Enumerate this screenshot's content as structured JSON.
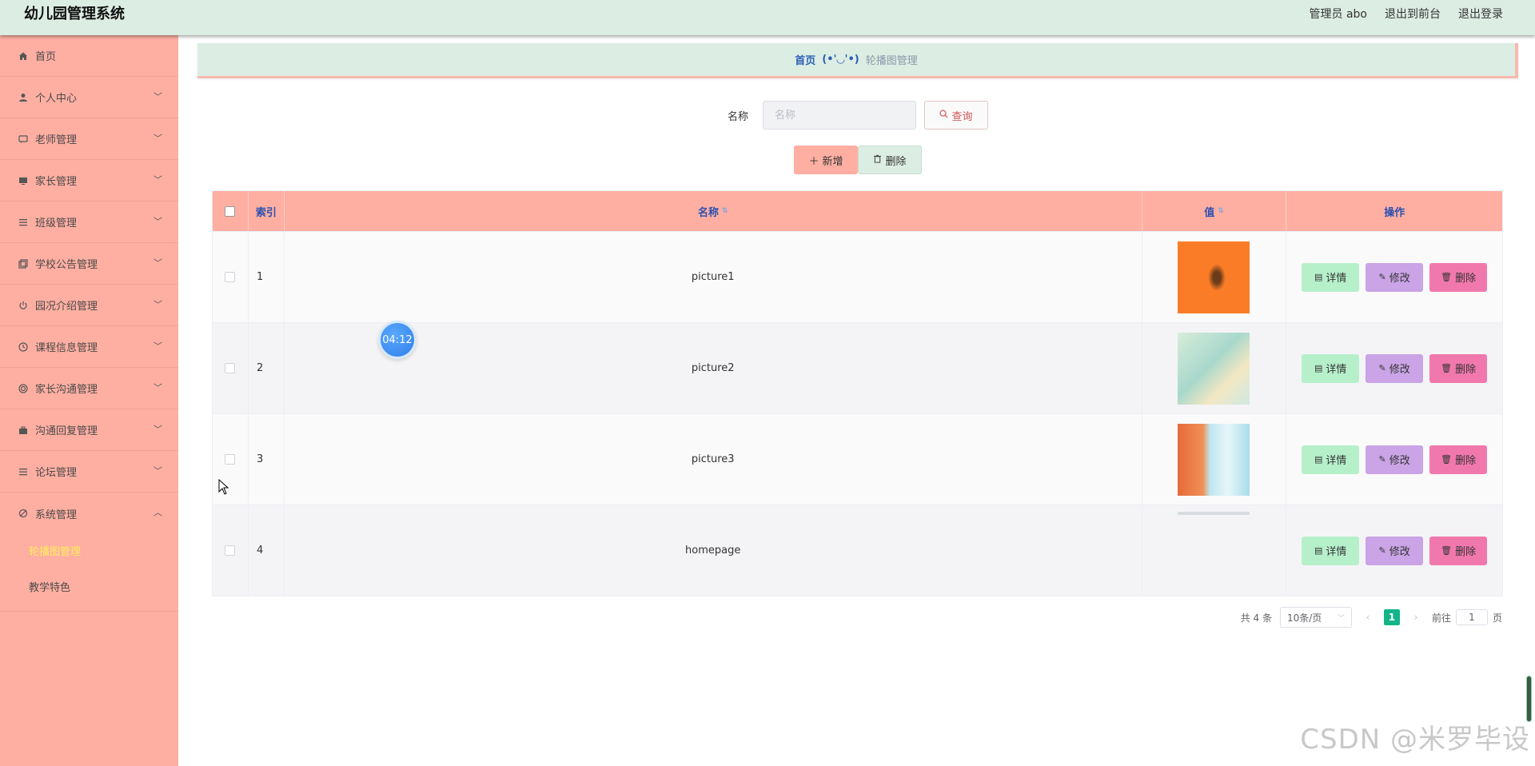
{
  "header": {
    "title": "幼儿园管理系统",
    "links": [
      "管理员 abo",
      "退出到前台",
      "退出登录"
    ]
  },
  "sidebar": {
    "items": [
      {
        "label": "首页",
        "icon": "home-icon"
      },
      {
        "label": "个人中心",
        "icon": "user-icon"
      },
      {
        "label": "老师管理",
        "icon": "chat-icon"
      },
      {
        "label": "家长管理",
        "icon": "monitor-icon"
      },
      {
        "label": "班级管理",
        "icon": "list-icon"
      },
      {
        "label": "学校公告管理",
        "icon": "copy-icon"
      },
      {
        "label": "园况介绍管理",
        "icon": "power-icon"
      },
      {
        "label": "课程信息管理",
        "icon": "clock-icon"
      },
      {
        "label": "家长沟通管理",
        "icon": "circle-icon"
      },
      {
        "label": "沟通回复管理",
        "icon": "briefcase-icon"
      },
      {
        "label": "论坛管理",
        "icon": "menu-icon"
      },
      {
        "label": "系统管理",
        "icon": "settings-icon"
      }
    ],
    "submenu": [
      "轮播图管理",
      "教学特色"
    ]
  },
  "breadcrumb": {
    "home": "首页",
    "face": "(•'◡'•)",
    "current": "轮播图管理"
  },
  "search": {
    "label": "名称",
    "placeholder": "名称",
    "query_label": "查询"
  },
  "actions": {
    "add_label": "新增",
    "delete_label": "删除"
  },
  "table": {
    "headers": [
      "索引",
      "名称",
      "值",
      "操作"
    ],
    "rows": [
      {
        "index": "1",
        "name": "picture1"
      },
      {
        "index": "2",
        "name": "picture2"
      },
      {
        "index": "3",
        "name": "picture3"
      },
      {
        "index": "4",
        "name": "homepage"
      }
    ],
    "row_actions": {
      "detail": "详情",
      "edit": "修改",
      "remove": "删除"
    }
  },
  "pagination": {
    "total": "共 4 条",
    "page_size": "10条/页",
    "current_page": "1",
    "goto_prefix": "前往",
    "goto_value": "1",
    "goto_suffix": "页"
  },
  "timer": "04:12",
  "watermark": "CSDN @米罗毕设",
  "colors": {
    "header_bg": "#dcede4",
    "sidebar_bg": "#ffafa2",
    "table_header_bg": "#ffafa2",
    "detail_btn": "#b6f0cb",
    "edit_btn": "#caa4e6",
    "remove_btn": "#f178ad",
    "pager_active": "#14b48a",
    "submenu_active": "#ffef5a"
  }
}
